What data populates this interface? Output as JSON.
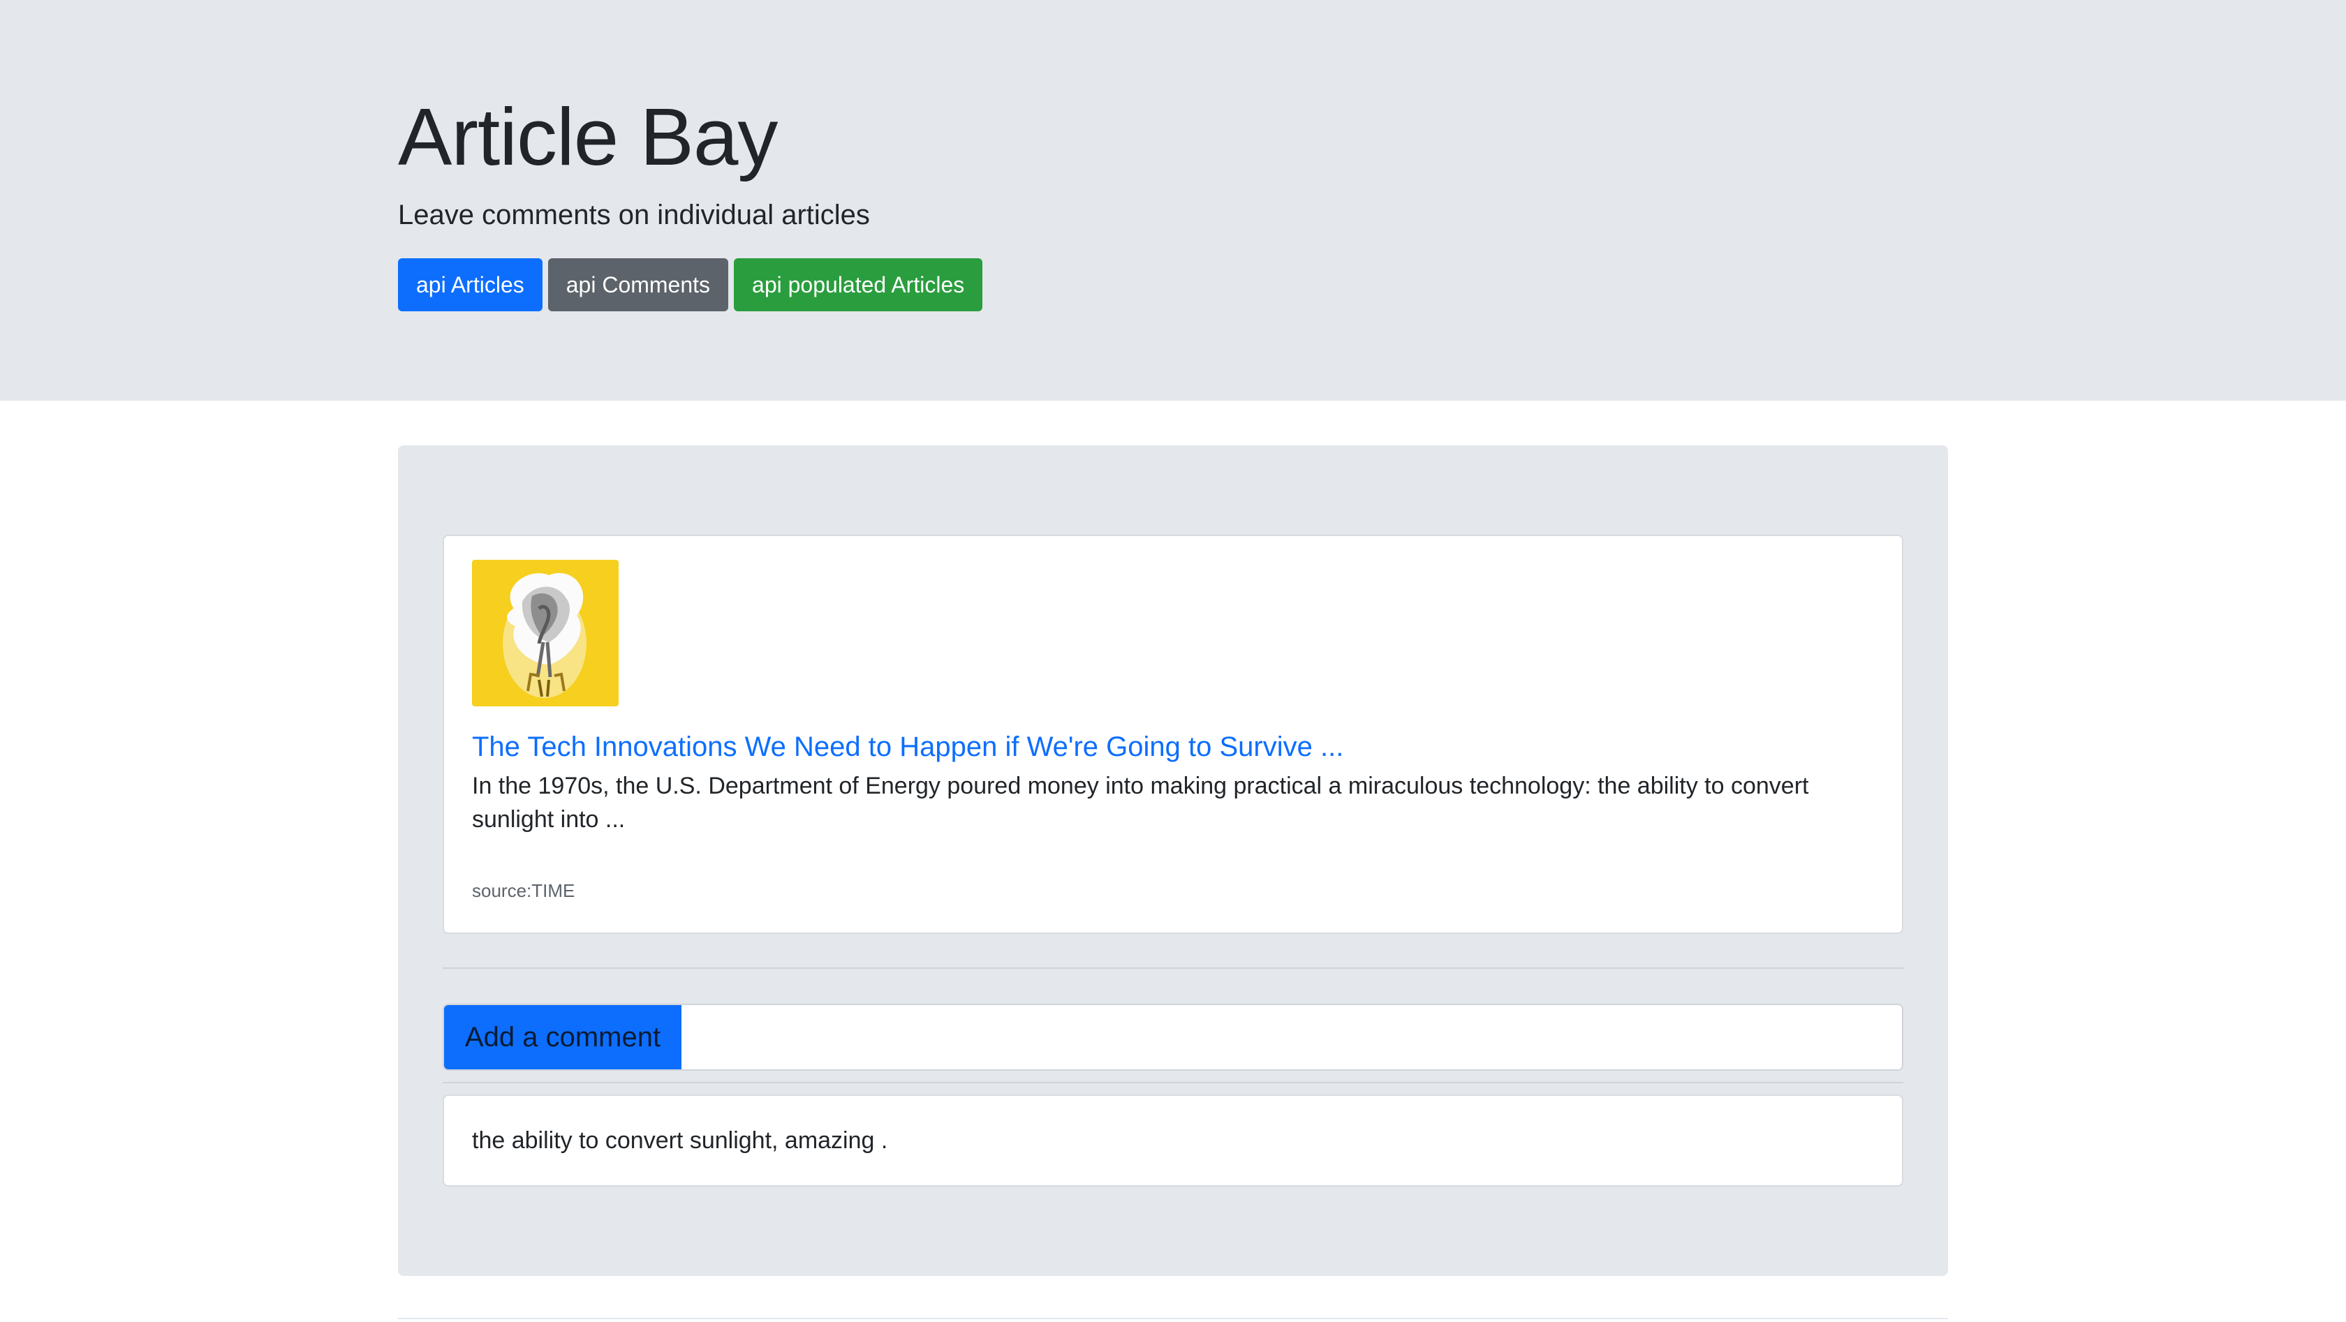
{
  "header": {
    "title": "Article Bay",
    "subtitle": "Leave comments on individual articles",
    "buttons": [
      {
        "label": "api Articles",
        "color": "#0d6efd"
      },
      {
        "label": "api Comments",
        "color": "#5c636a"
      },
      {
        "label": "api populated Articles",
        "color": "#2a9d3e"
      }
    ]
  },
  "article": {
    "thumbnail_icon": "lightbulb-smoke-illustration",
    "title": "The Tech Innovations We Need to Happen if We're Going to Survive ...",
    "summary": "In the 1970s, the U.S. Department of Energy poured money into making practical a miraculous technology: the ability to convert sunlight into ...",
    "source": "source:TIME"
  },
  "comment_form": {
    "button_label": "Add a comment",
    "input_value": "",
    "placeholder": ""
  },
  "comments": [
    {
      "text": "the ability to convert sunlight, amazing ."
    }
  ],
  "colors": {
    "jumbotron_bg": "#e4e7ec",
    "link": "#0d6efd",
    "thumbnail_bg": "#f6cf1f"
  }
}
